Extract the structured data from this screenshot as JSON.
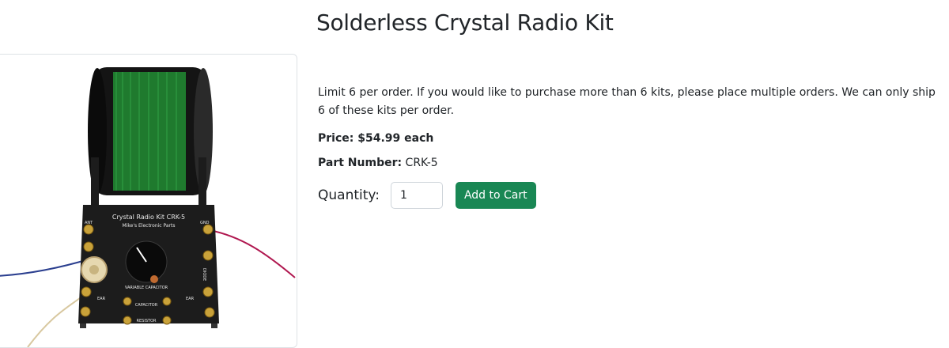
{
  "product": {
    "title": "Solderless Crystal Radio Kit",
    "description": "Limit 6 per order. If you would like to purchase more than 6 kits, please place multiple orders. We can only ship 6 of these kits per order.",
    "price_text": "Price: $54.99 each",
    "part_number_label": "Part Number:",
    "part_number_value": " CRK-5"
  },
  "cart": {
    "quantity_label": "Quantity:",
    "quantity_value": "1",
    "add_button_label": "Add to Cart"
  },
  "photo": {
    "board_title": "Crystal Radio Kit CRK-5",
    "board_subtitle": "Mike's Electronic Parts",
    "label_capacitor_var": "VARIABLE CAPACITOR",
    "label_capacitor": "CAPACITOR",
    "label_resistor": "RESISTOR",
    "label_ear_left": "EAR",
    "label_ear_right": "EAR",
    "label_ant": "ANT",
    "label_gnd": "GND",
    "label_diode": "DIODE"
  },
  "colors": {
    "accent": "#198754",
    "coil_green": "#1f7a2e",
    "board": "#1c1c1c"
  }
}
